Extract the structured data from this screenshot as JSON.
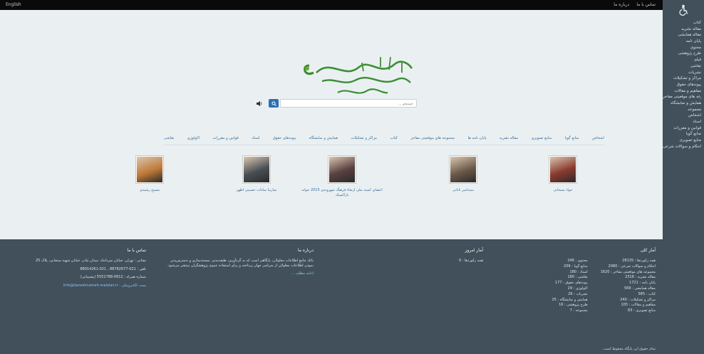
{
  "topbar": {
    "left_label": "English",
    "right_items": [
      "تماس با ما",
      "درباره ما"
    ]
  },
  "sidebar": {
    "items": [
      "کتاب",
      "مقاله نشریه",
      "مقاله همایشی",
      "پایان نامه",
      "محتوی",
      "طرح پژوهشی",
      "فیلم",
      "نقاشی",
      "نشریات",
      "مراکز و تشکیلات",
      "پیوندهای حقوق",
      "مفاهیم و مقالات",
      "مجموعه های موقعیتی مفاخر",
      "همایش و نمایشگاه",
      "مجموعه",
      "اشخاص",
      "اسناد",
      "قوانین و مقررات",
      "منابع گویا",
      "منابع تصویری",
      "احکام و سوالات شرعی"
    ]
  },
  "logo": {
    "text": "بانک جامع اطلاعات معلولان"
  },
  "search": {
    "placeholder": "جستجو ...",
    "lang_symbol": "◀"
  },
  "categories": [
    "اشخاص",
    "منابع گویا",
    "منابع تصویری",
    "مقاله نشریه",
    "پایان نامه ها",
    "مجموعه های موقعیتی مفاخر",
    "کتاب",
    "مراکز و تشکیلات",
    "همایش و نمایشگاه",
    "پیوندهای حقوق",
    "اسناد",
    "قوانین و مقررات",
    "اکولوژی",
    "نقاشی"
  ],
  "people": [
    {
      "name": "جواد سبحانی",
      "color": "#8a3a2e"
    },
    {
      "name": "سیدامیر تابانی",
      "color": "#6b5a4a"
    },
    {
      "name": "اعضای کمیته ملی ارتقاء فرهنگ شهروندی 2015 جوانه پارالمپیک",
      "color": "#5a4040"
    },
    {
      "name": "سارینا سادات حسینی اطهر",
      "color": "#4a4f55"
    },
    {
      "name": "مسیح رشیدی",
      "color": "#c07a38"
    }
  ],
  "footer": {
    "stats_title": "آمار کلی",
    "stats_col1": [
      "همه رکوردها : 28135",
      "احکام و سوالات شرعی : 2080",
      "مجموعه های موقعیتی مفاخر : 1620",
      "مقاله نشریه : 2316",
      "پایان نامه : 1721",
      "مقاله همایشی : 569",
      "کتاب : 585",
      "مراکز و تشکیلات : 240",
      "مفاهیم و مقالات : 105",
      "منابع تصویری : 83"
    ],
    "stats_col2": [
      "محتوی : 246",
      "منابع گویا : 209",
      "اسناد : 180",
      "نقاشی : 180",
      "پیوندهای حقوق : 177",
      "اکولوژی : 29",
      "نشریات : 26",
      "همایش و نمایشگاه : 25",
      "طرح پژوهشی : 16",
      "مجموعه : 7"
    ],
    "today_title": "آمار امروز",
    "today_line": "همه رکوردها : 0",
    "about_title": "درباره ما",
    "about_text": "بانک جامع اطلاعات معلولان، پایگاهی است که به گردآوری، طبقه‌بندی، مستندسازی و دسترس‌پذیر نمودن اطلاعات معلولان از سراسر جهان پرداخته و برای استفاده عموم پژوهشگران منتشر می‌شود.",
    "about_link": "ادامه مطلب ...",
    "contact_title": "تماس با ما",
    "contact_lines": [
      "نشانی : تهران، خیابان میرداماد، میدان مادر، خیابان شهید سنجابی، پلاک 25",
      "تلفن : 021-88782677 , 021-88914261",
      "شماره همراه : 0912-5551788 (پشتیبانی)",
      "پست الکترونیکی : info@daneshnameh-malolan.ir"
    ],
    "copyright": "تمام حقوق این پایگاه محفوظ است."
  }
}
